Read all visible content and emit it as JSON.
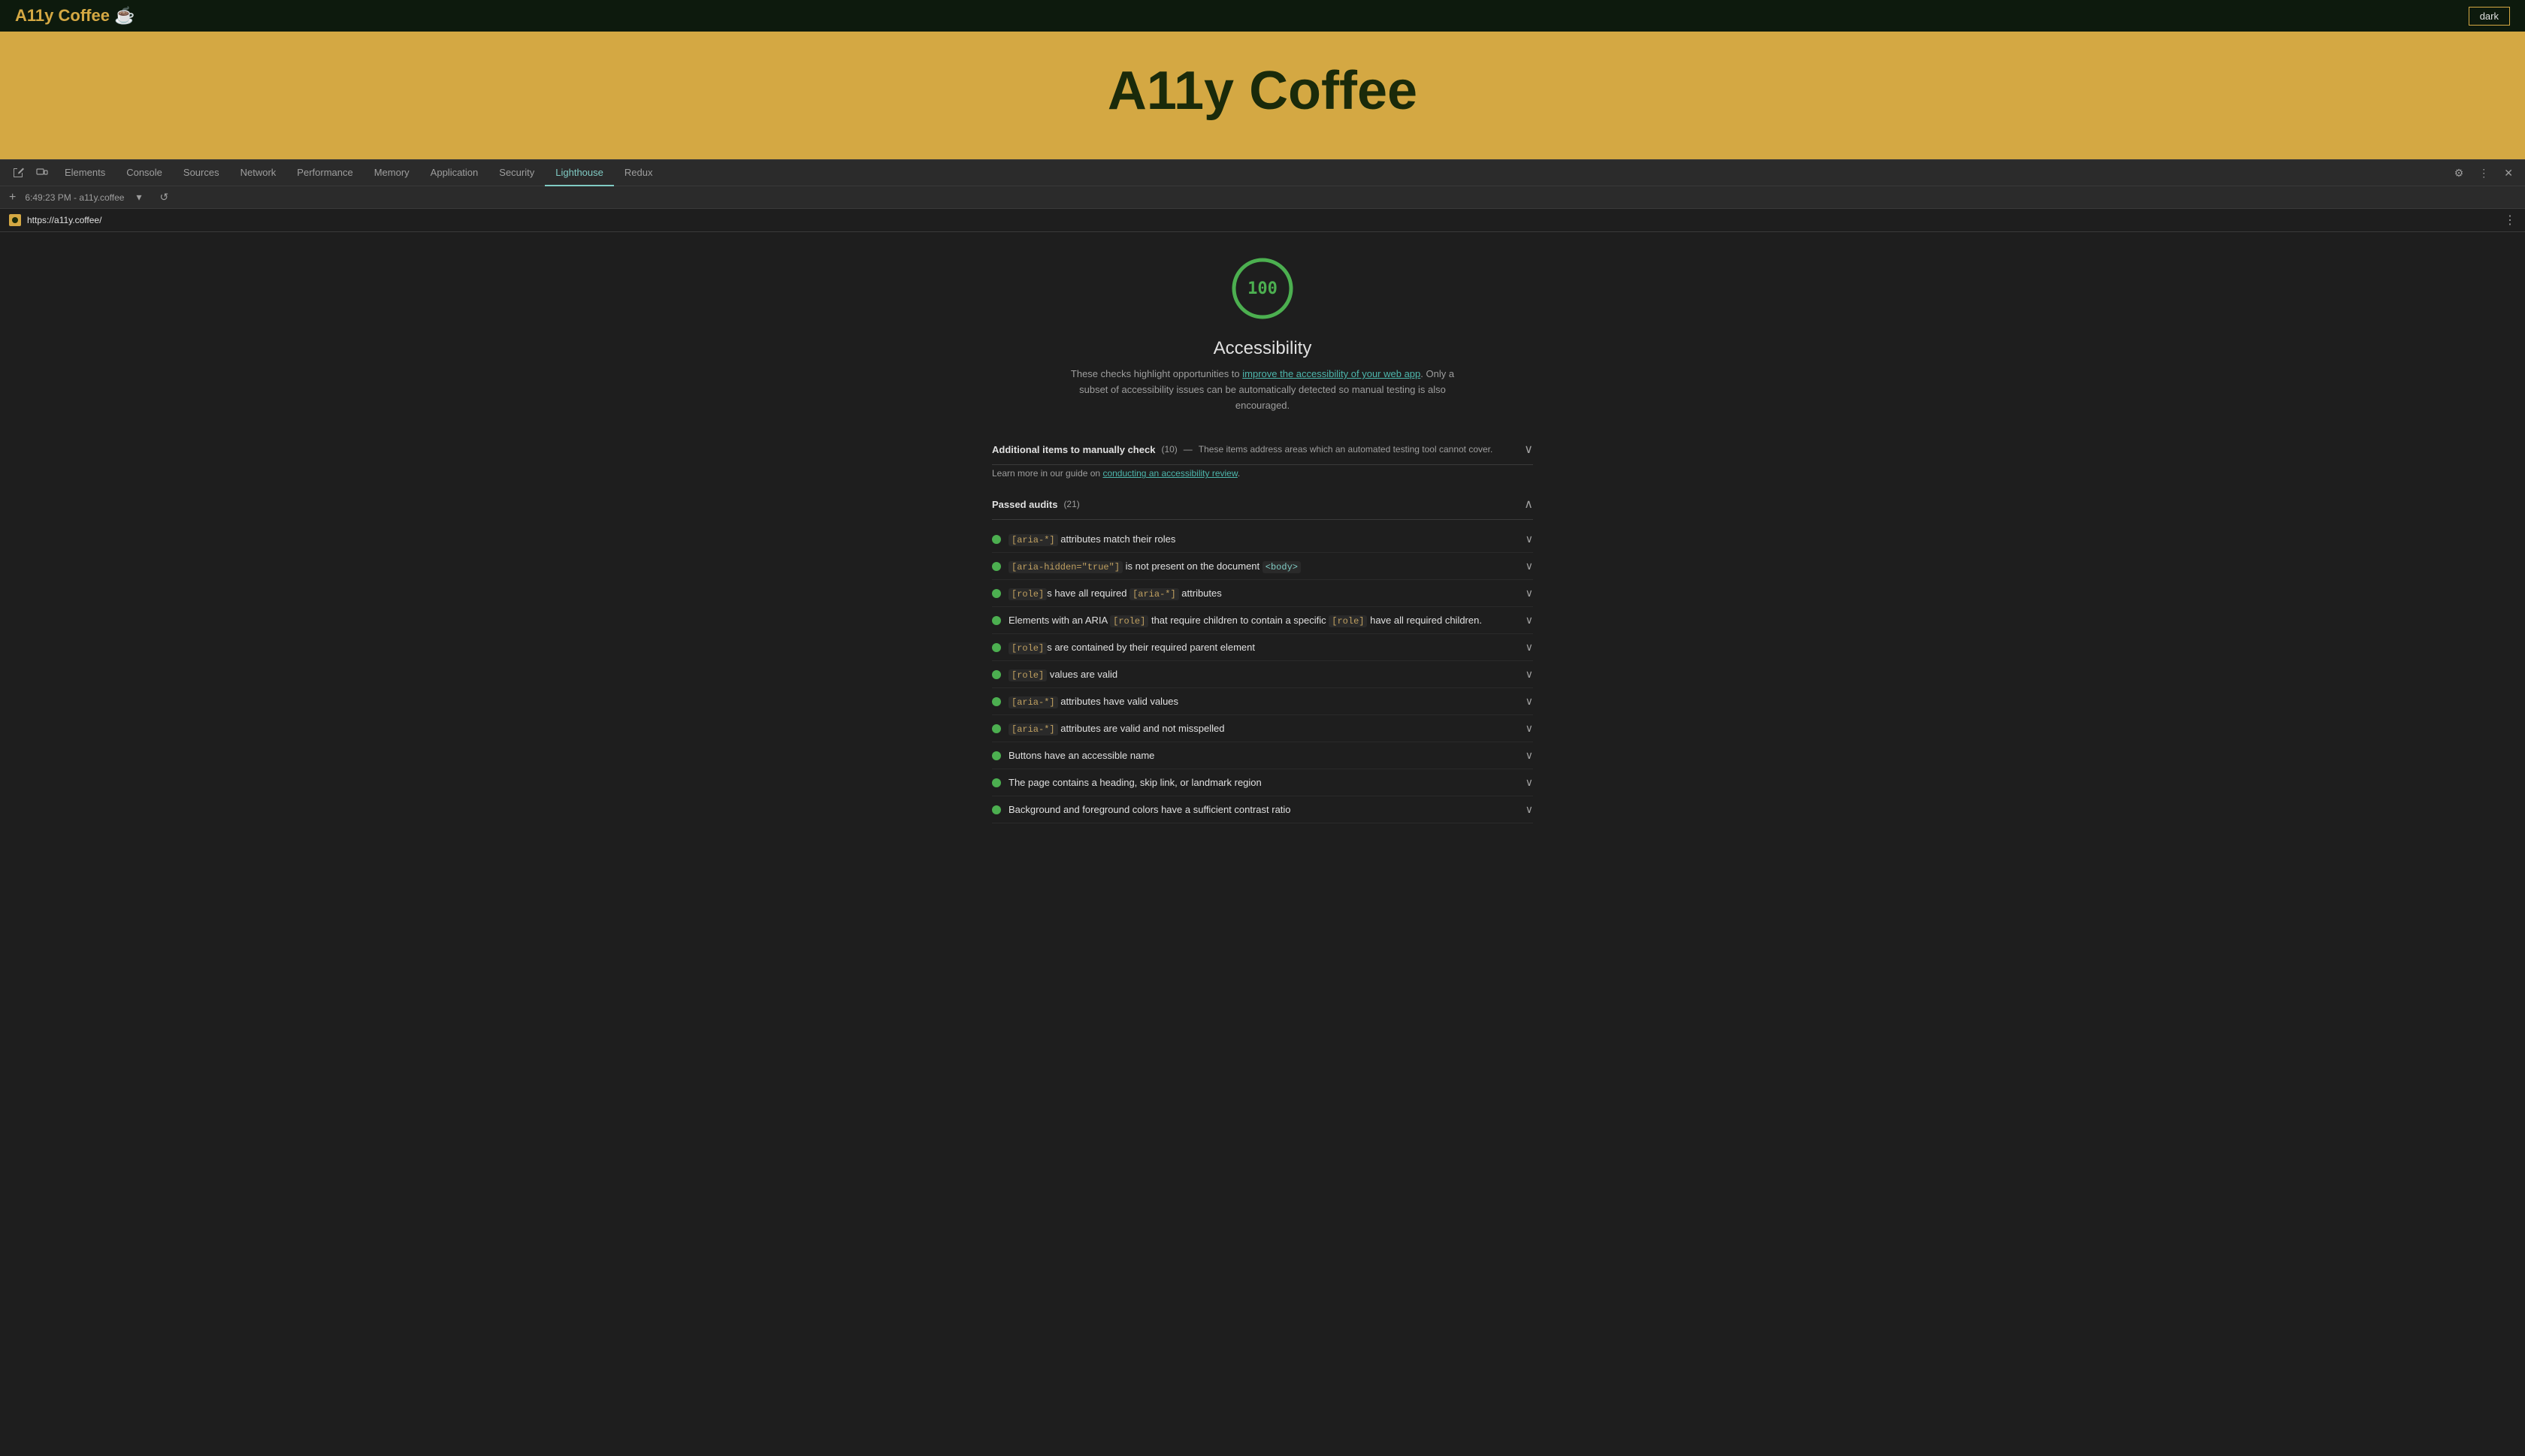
{
  "website": {
    "nav_title": "A11y Coffee ☕",
    "dark_button": "dark",
    "heading": "A11y Coffee"
  },
  "devtools": {
    "tabs": [
      {
        "label": "Elements",
        "active": false
      },
      {
        "label": "Console",
        "active": false
      },
      {
        "label": "Sources",
        "active": false
      },
      {
        "label": "Network",
        "active": false
      },
      {
        "label": "Performance",
        "active": false
      },
      {
        "label": "Memory",
        "active": false
      },
      {
        "label": "Application",
        "active": false
      },
      {
        "label": "Security",
        "active": false
      },
      {
        "label": "Lighthouse",
        "active": true
      },
      {
        "label": "Redux",
        "active": false
      }
    ],
    "secondary_bar": {
      "time": "6:49:23 PM",
      "url_short": "a11y.coffee"
    },
    "url_bar": {
      "url": "https://a11y.coffee/"
    }
  },
  "lighthouse": {
    "score": "100",
    "title": "Accessibility",
    "description_before": "These checks highlight opportunities to ",
    "description_link1_text": "improve the accessibility of your web app",
    "description_link1_href": "#",
    "description_middle": ". Only a subset of accessibility issues can be automatically detected so manual testing is also encouraged.",
    "manual_section": {
      "title": "Additional items to manually check",
      "count": "(10)",
      "dash": "—",
      "description": "These items address areas which an automated testing tool cannot cover.",
      "subtext_before": "Learn more in our guide on ",
      "subtext_link": "conducting an accessibility review",
      "subtext_after": "."
    },
    "passed_section": {
      "title": "Passed audits",
      "count": "(21)"
    },
    "audits": [
      {
        "text_parts": [
          "[aria-*] attributes match their roles"
        ],
        "code": "[aria-*]",
        "suffix": " attributes match their roles"
      },
      {
        "code1": "[aria-hidden=\"true\"]",
        "suffix": " is not present on the document ",
        "code2": "<body>"
      },
      {
        "code1": "[role]",
        "suffix": "s have all required ",
        "code2": "[aria-*]",
        "suffix2": " attributes"
      },
      {
        "plain": "Elements with an ARIA ",
        "code1": "[role]",
        "middle": " that require children to contain a specific ",
        "code2": "[role]",
        "suffix": " have all required children."
      },
      {
        "code1": "[role]",
        "suffix": "s are contained by their required parent element"
      },
      {
        "code1": "[role]",
        "suffix": " values are valid"
      },
      {
        "code1": "[aria-*]",
        "suffix": " attributes have valid values"
      },
      {
        "code1": "[aria-*]",
        "suffix": " attributes are valid and not misspelled"
      },
      {
        "plain": "Buttons have an accessible name"
      },
      {
        "plain": "The page contains a heading, skip link, or landmark region"
      },
      {
        "plain": "Background and foreground colors have a sufficient contrast ratio"
      }
    ]
  }
}
